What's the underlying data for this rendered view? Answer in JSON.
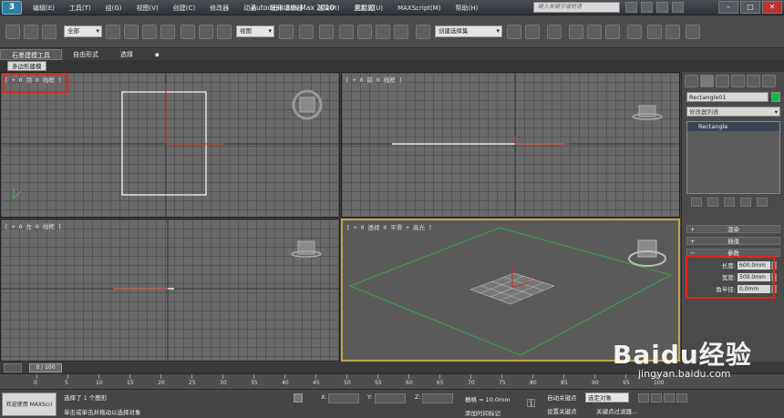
{
  "titlebar": {
    "logo": "3",
    "menus": [
      "编辑(E)",
      "工具(T)",
      "组(G)",
      "视图(V)",
      "创建(C)",
      "修改器",
      "动画",
      "图形编辑器",
      "渲染(R)",
      "自定义(U)",
      "MAXScript(M)",
      "帮助(H)"
    ],
    "app_title": "Autodesk 3ds Max  2010",
    "doc_title": "无标题",
    "search_placeholder": "键入关键字或短语"
  },
  "toolbar": {
    "filter_select": "全部",
    "view_select": "视图",
    "named_selection": "创建选择集"
  },
  "ribbon": {
    "tabs": [
      "石墨建模工具",
      "自由形式",
      "选择"
    ],
    "subtab": "多边形建模"
  },
  "viewports": {
    "top": "[ + 0 顶 0 线框 ]",
    "front": "[ + 0 前 0 线框 ]",
    "left": "[ + 0 左 0 线框 ]",
    "perspective": "[ + 0 透视 0 平滑 + 高光 ]"
  },
  "command_panel": {
    "object_name": "Rectangle01",
    "object_color": "#19b34a",
    "modifier_list": "修改器列表",
    "stack_item": "Rectangle",
    "rollouts": [
      "渲染",
      "插值",
      "参数"
    ],
    "params": [
      {
        "label": "长度:",
        "value": "600.0mm"
      },
      {
        "label": "宽度:",
        "value": "500.0mm"
      },
      {
        "label": "角半径:",
        "value": "0.0mm"
      }
    ]
  },
  "timeline": {
    "slider": "0 / 100",
    "ticks": [
      "0",
      "5",
      "10",
      "15",
      "20",
      "25",
      "30",
      "35",
      "40",
      "45",
      "50",
      "55",
      "60",
      "65",
      "70",
      "75",
      "80",
      "85",
      "90",
      "95",
      "100"
    ]
  },
  "status": {
    "welcome": "欢迎使用 MAXScri",
    "selected": "选择了 1 个图形",
    "hint": "单击或单击并拖动以选择对象",
    "x_label": "X:",
    "y_label": "Y:",
    "z_label": "Z:",
    "grid": "栅格 = 10.0mm",
    "add_time_tag": "添加时间标记",
    "auto_key": "自动关键点",
    "set_key": "设置关键点",
    "selected_drop": "选定对象",
    "key_filters": "关键点过滤器..."
  },
  "watermark": {
    "brand": "Baidu经验",
    "url": "jingyan.baidu.com"
  },
  "highlight_color": "#e0261f"
}
